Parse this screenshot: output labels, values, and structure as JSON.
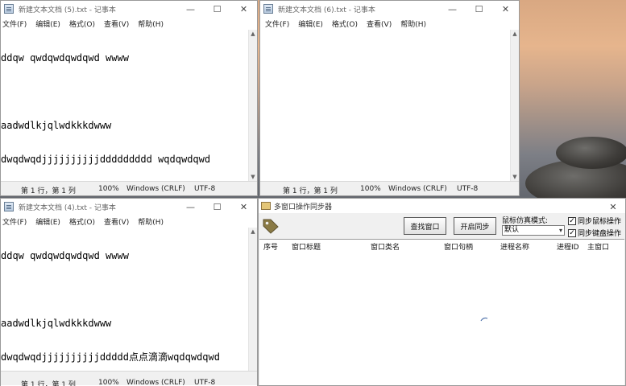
{
  "windows": [
    {
      "title": "新建文本文档 (5).txt - 记事本",
      "menus": [
        "文件(F)",
        "编辑(E)",
        "格式(O)",
        "查看(V)",
        "帮助(H)"
      ],
      "lines": [
        "ddqw qwdqwdqwdqwd wwww",
        "",
        "aadwdlkjqlwdkkkdwww",
        "dwqdwqdjjjjjjjjjjddddddddd wqdqwdqwd"
      ],
      "status": {
        "position": "第 1 行，第 1 列",
        "zoom": "100%",
        "eol": "Windows (CRLF)",
        "encoding": "UTF-8"
      }
    },
    {
      "title": "新建文本文档 (6).txt - 记事本",
      "menus": [
        "文件(F)",
        "编辑(E)",
        "格式(O)",
        "查看(V)",
        "帮助(H)"
      ],
      "lines": [],
      "status": {
        "position": "第 1 行，第 1 列",
        "zoom": "100%",
        "eol": "Windows (CRLF)",
        "encoding": "UTF-8"
      }
    },
    {
      "title": "新建文本文档 (4).txt - 记事本",
      "menus": [
        "文件(F)",
        "编辑(E)",
        "格式(O)",
        "查看(V)",
        "帮助(H)"
      ],
      "lines": [
        "ddqw qwdqwdqwdqwd wwww",
        "",
        "aadwdlkjqlwdkkkdwww",
        "dwqdwqdjjjjjjjjjjddddd点点滴滴wqdqwdqwd"
      ],
      "status": {
        "position": "第 1 行，第 1 列",
        "zoom": "100%",
        "eol": "Windows (CRLF)",
        "encoding": "UTF-8"
      }
    }
  ],
  "controls": {
    "minimize": "—",
    "maximize": "☐",
    "close": "✕"
  },
  "tool": {
    "title": "多窗口操作同步器",
    "find_button": "查找窗口",
    "sync_button": "开启同步",
    "mouse_mode_label": "鼠标仿真模式:",
    "mouse_mode_value": "默认",
    "sync_mouse": {
      "label": "同步鼠标操作",
      "checked": true
    },
    "sync_keyboard": {
      "label": "同步键盘操作",
      "checked": true
    },
    "columns": [
      "序号",
      "窗口标题",
      "窗口类名",
      "窗口句柄",
      "进程名称",
      "进程ID",
      "主窗口"
    ]
  },
  "icons": {
    "check": "✓",
    "scroll_up": "▲",
    "scroll_down": "▼",
    "caret": "▾"
  },
  "colors": {
    "desktop_sky": "#e6b58d",
    "sea": "#4a5058",
    "tag": "#8a7a45"
  }
}
